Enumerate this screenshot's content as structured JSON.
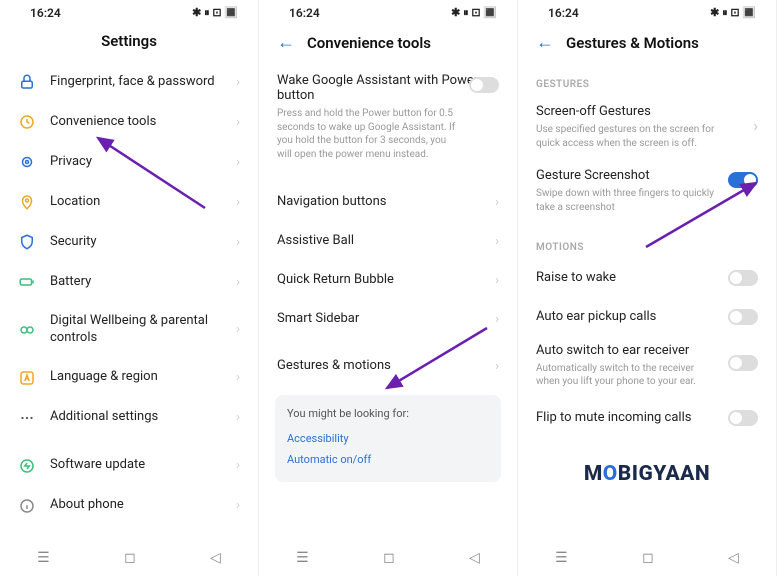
{
  "status": {
    "time": "16:24",
    "icons": "✱ ⏸ ⊡ 🔳"
  },
  "screen1": {
    "title": "Settings",
    "items": [
      {
        "label": "Fingerprint, face & password"
      },
      {
        "label": "Convenience tools"
      },
      {
        "label": "Privacy"
      },
      {
        "label": "Location"
      },
      {
        "label": "Security"
      },
      {
        "label": "Battery"
      },
      {
        "label": "Digital Wellbeing & parental controls"
      },
      {
        "label": "Language & region"
      },
      {
        "label": "Additional settings"
      },
      {
        "label": "Software update"
      },
      {
        "label": "About phone"
      }
    ]
  },
  "screen2": {
    "title": "Convenience tools",
    "wake": {
      "title": "Wake Google Assistant with Power button",
      "desc": "Press and hold the Power button for 0.5 seconds to wake up Google Assistant. If you hold the button for 3 seconds, you will open the power menu instead."
    },
    "items": [
      {
        "label": "Navigation buttons"
      },
      {
        "label": "Assistive Ball"
      },
      {
        "label": "Quick Return Bubble"
      },
      {
        "label": "Smart Sidebar"
      },
      {
        "label": "Gestures & motions"
      }
    ],
    "suggest": {
      "header": "You might be looking for:",
      "links": [
        "Accessibility",
        "Automatic on/off"
      ]
    }
  },
  "screen3": {
    "title": "Gestures & Motions",
    "gestures_hdr": "GESTURES",
    "motions_hdr": "MOTIONS",
    "g1": {
      "title": "Screen-off Gestures",
      "desc": "Use specified gestures on the screen for quick access when the screen is off."
    },
    "g2": {
      "title": "Gesture Screenshot",
      "desc": "Swipe down with three fingers to quickly take a screenshot"
    },
    "m1": {
      "title": "Raise to wake"
    },
    "m2": {
      "title": "Auto ear pickup calls"
    },
    "m3": {
      "title": "Auto switch to ear receiver",
      "desc": "Automatically switch to the receiver when you lift your phone to your ear."
    },
    "m4": {
      "title": "Flip to mute incoming calls"
    },
    "logo_pre": "M",
    "logo_o": "O",
    "logo_post": "BIGYAAN"
  }
}
